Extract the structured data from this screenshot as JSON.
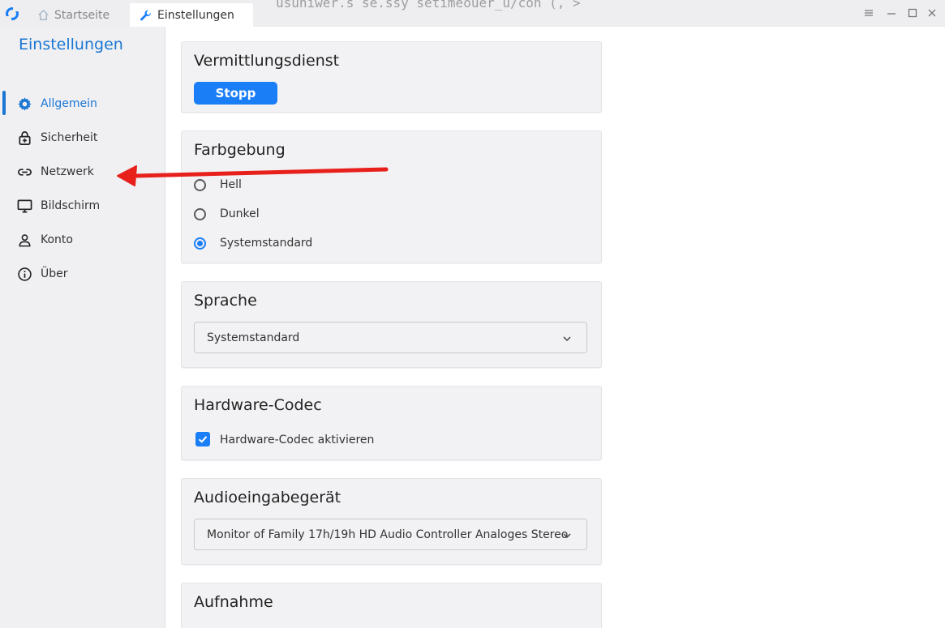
{
  "titlebar": {
    "tabs": [
      {
        "label": "Startseite",
        "icon": "home-icon"
      },
      {
        "label": "Einstellungen",
        "icon": "wrench-icon"
      }
    ],
    "background_code": "usuniwer.s se.ssy  setimeouer_u/con (, >"
  },
  "sidebar": {
    "title": "Einstellungen",
    "items": [
      {
        "label": "Allgemein",
        "icon": "gear-icon",
        "active": true
      },
      {
        "label": "Sicherheit",
        "icon": "lock-icon",
        "active": false
      },
      {
        "label": "Netzwerk",
        "icon": "link-icon",
        "active": false
      },
      {
        "label": "Bildschirm",
        "icon": "monitor-icon",
        "active": false
      },
      {
        "label": "Konto",
        "icon": "person-icon",
        "active": false
      },
      {
        "label": "Über",
        "icon": "info-icon",
        "active": false
      }
    ]
  },
  "sections": {
    "relay": {
      "title": "Vermittlungsdienst",
      "button": "Stopp"
    },
    "theme": {
      "title": "Farbgebung",
      "options": [
        {
          "label": "Hell",
          "selected": false
        },
        {
          "label": "Dunkel",
          "selected": false
        },
        {
          "label": "Systemstandard",
          "selected": true
        }
      ]
    },
    "language": {
      "title": "Sprache",
      "value": "Systemstandard"
    },
    "codec": {
      "title": "Hardware-Codec",
      "checkbox_label": "Hardware-Codec aktivieren",
      "checked": true
    },
    "audio": {
      "title": "Audioeingabegerät",
      "value": "Monitor of Family 17h/19h HD Audio Controller Analoges Stereo"
    },
    "recording": {
      "title": "Aufnahme"
    }
  },
  "colors": {
    "accent": "#1976d2",
    "primary_button": "#1a7ef7",
    "annotation_arrow": "#e8201c"
  }
}
